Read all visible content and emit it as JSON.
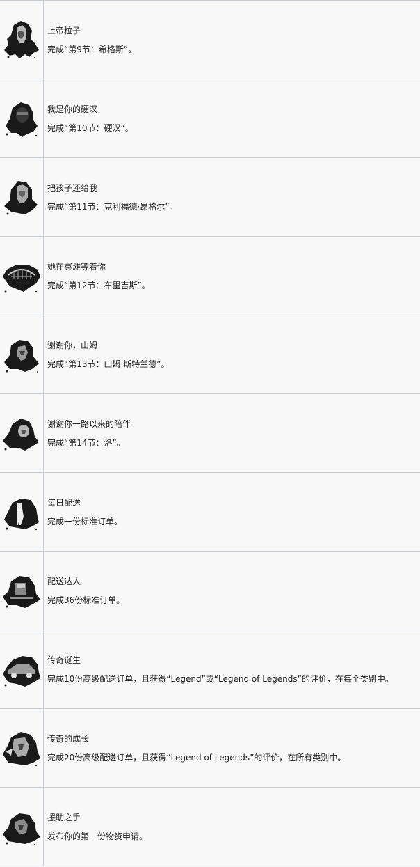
{
  "achievements": [
    {
      "title": "上帝粒子",
      "desc": "完成“第9节：希格斯”。",
      "icon": "higgs-portrait-icon"
    },
    {
      "title": "我是你的硬汉",
      "desc": "完成“第10节：硬汉”。",
      "icon": "die-hardman-portrait-icon"
    },
    {
      "title": "把孩子还给我",
      "desc": "完成“第11节：克利福德·昂格尔”。",
      "icon": "cliff-unger-portrait-icon"
    },
    {
      "title": "她在冥滩等着你",
      "desc": "完成“第12节：布里吉斯”。",
      "icon": "bridges-emblem-icon"
    },
    {
      "title": "谢谢你，山姆",
      "desc": "完成“第13节：山姆·斯特兰德”。",
      "icon": "sam-portrait-icon"
    },
    {
      "title": "谢谢你一路以来的陪伴",
      "desc": "完成“第14节：洛”。",
      "icon": "lou-portrait-icon"
    },
    {
      "title": "每日配送",
      "desc": "完成一份标准订单。",
      "icon": "porter-silhouette-icon"
    },
    {
      "title": "配送达人",
      "desc": "完成36份标准订单。",
      "icon": "cargo-porter-icon"
    },
    {
      "title": "传奇诞生",
      "desc": "完成10份高级配送订单，且获得“Legend”或“Legend of Legends”的评价，在每个类别中。",
      "icon": "vehicle-legend-icon"
    },
    {
      "title": "传奇的成长",
      "desc": "完成20份高级配送订单，且获得“Legend of Legends”的评价，在所有类别中。",
      "icon": "legend-growth-icon"
    },
    {
      "title": "援助之手",
      "desc": "发布你的第一份物资申请。",
      "icon": "helping-hand-icon"
    }
  ]
}
